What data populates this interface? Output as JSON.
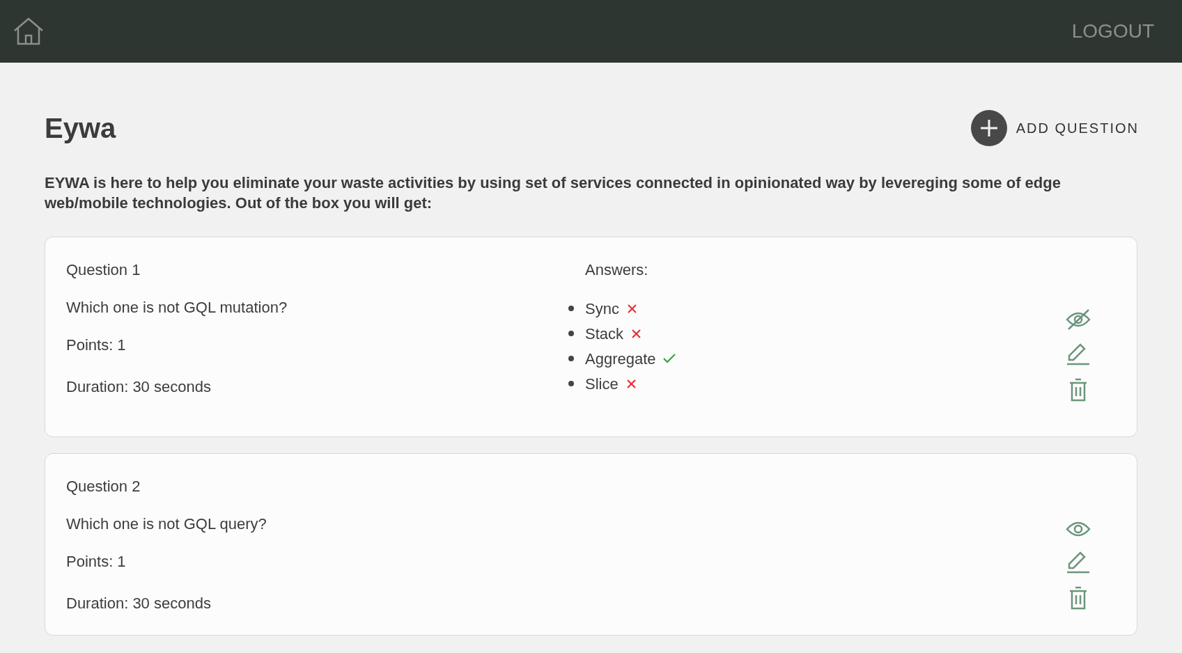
{
  "header": {
    "logout": "LOGOUT"
  },
  "title": "Eywa",
  "add_button": "ADD QUESTION",
  "description": "EYWA is here to help you eliminate your waste activities by using set of services connected in opinionated way by levereging some of edge web/mobile technologies. Out of the box you will get:",
  "questions": [
    {
      "heading": "Question 1",
      "text": "Which one is not GQL mutation?",
      "points": "Points: 1",
      "duration": "Duration: 30 seconds",
      "answers_visible": true,
      "answers_label": "Answers:",
      "answers": [
        {
          "text": "Sync",
          "correct": false
        },
        {
          "text": "Stack",
          "correct": false
        },
        {
          "text": "Aggregate",
          "correct": true
        },
        {
          "text": "Slice",
          "correct": false
        }
      ]
    },
    {
      "heading": "Question 2",
      "text": "Which one is not GQL query?",
      "points": "Points: 1",
      "duration": "Duration: 30 seconds",
      "answers_visible": false
    }
  ]
}
